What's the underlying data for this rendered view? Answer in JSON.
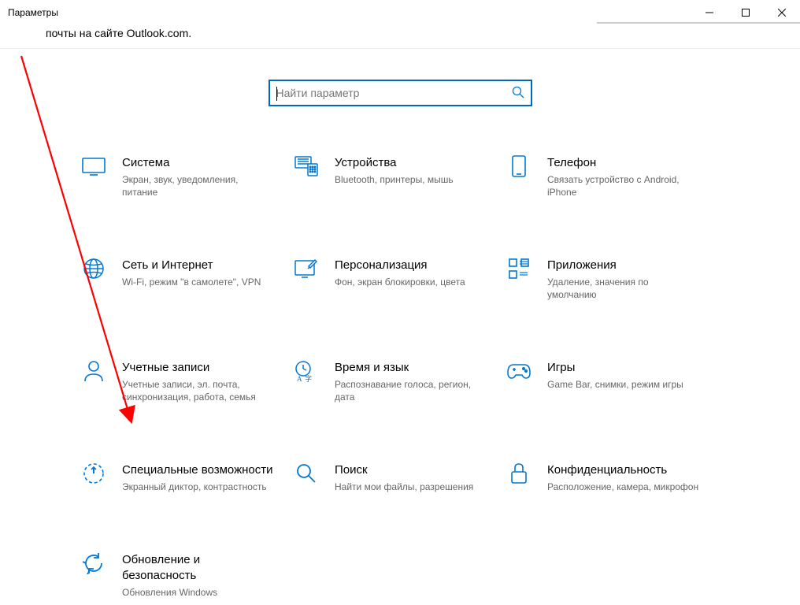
{
  "window": {
    "title": "Параметры",
    "subtitle": "почты на сайте Outlook.com."
  },
  "search": {
    "placeholder": "Найти параметр"
  },
  "categories": [
    {
      "id": "system",
      "title": "Система",
      "desc": "Экран, звук, уведомления, питание"
    },
    {
      "id": "devices",
      "title": "Устройства",
      "desc": "Bluetooth, принтеры, мышь"
    },
    {
      "id": "phone",
      "title": "Телефон",
      "desc": "Связать устройство с Android, iPhone"
    },
    {
      "id": "network",
      "title": "Сеть и Интернет",
      "desc": "Wi-Fi, режим \"в самолете\", VPN"
    },
    {
      "id": "personalization",
      "title": "Персонализация",
      "desc": "Фон, экран блокировки, цвета"
    },
    {
      "id": "apps",
      "title": "Приложения",
      "desc": "Удаление, значения по умолчанию"
    },
    {
      "id": "accounts",
      "title": "Учетные записи",
      "desc": "Учетные записи, эл. почта, синхронизация, работа, семья"
    },
    {
      "id": "time",
      "title": "Время и язык",
      "desc": "Распознавание голоса, регион, дата"
    },
    {
      "id": "gaming",
      "title": "Игры",
      "desc": "Game Bar, снимки, режим игры"
    },
    {
      "id": "ease",
      "title": "Специальные возможности",
      "desc": "Экранный диктор, контрастность"
    },
    {
      "id": "search",
      "title": "Поиск",
      "desc": "Найти мои файлы, разрешения"
    },
    {
      "id": "privacy",
      "title": "Конфиденциальность",
      "desc": "Расположение, камера, микрофон"
    },
    {
      "id": "update",
      "title": "Обновление и безопасность",
      "desc": "Обновления Windows"
    }
  ]
}
